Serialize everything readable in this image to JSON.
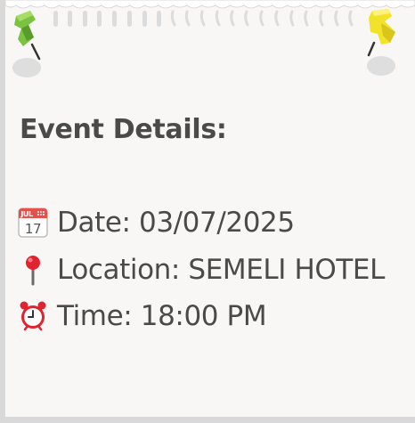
{
  "card": {
    "title": "Event Details:",
    "details": [
      {
        "icon": "calendar-icon",
        "label": "Date: 03/07/2025"
      },
      {
        "icon": "location-pin-icon",
        "label": "Location: SEMELI HOTEL"
      },
      {
        "icon": "alarm-clock-icon",
        "label": "Time: 18:00 PM"
      }
    ],
    "calendar_icon": {
      "month": "JUL",
      "day": "17"
    }
  },
  "colors": {
    "paper": "#f8f7f5",
    "text": "#4a4a4a",
    "pin_green": "#7cc242",
    "pin_yellow": "#f2e22a"
  }
}
